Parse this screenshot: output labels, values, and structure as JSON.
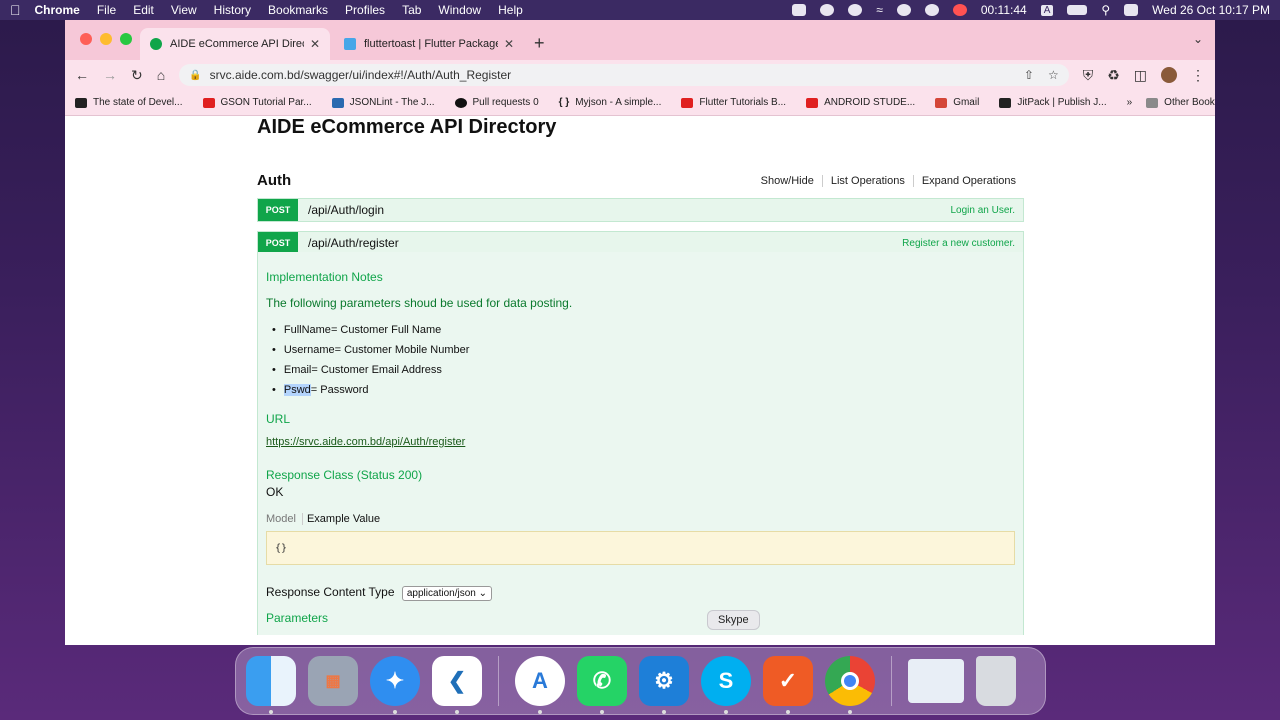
{
  "menubar": {
    "app": "Chrome",
    "items": [
      "File",
      "Edit",
      "View",
      "History",
      "Bookmarks",
      "Profiles",
      "Tab",
      "Window",
      "Help"
    ],
    "timer": "00:11:44",
    "keyboard": "A",
    "datetime": "Wed 26 Oct  10:17 PM"
  },
  "tabs": [
    {
      "title": "AIDE eCommerce API Directory",
      "favicon_color": "#10a54a"
    },
    {
      "title": "fluttertoast | Flutter Package",
      "favicon_color": "#47a6e8"
    }
  ],
  "address": {
    "url": "srvc.aide.com.bd/swagger/ui/index#!/Auth/Auth_Register"
  },
  "bookmarks": [
    {
      "label": "The state of Devel...",
      "icon_color": "#222"
    },
    {
      "label": "GSON Tutorial Par...",
      "icon_color": "#e02020"
    },
    {
      "label": "JSONLint - The J...",
      "icon_color": "#2a6ab0"
    },
    {
      "label": "Pull requests 0",
      "icon_color": "#111"
    },
    {
      "label": "Myjson - A simple...",
      "icon_color": "#444"
    },
    {
      "label": "Flutter Tutorials B...",
      "icon_color": "#e02020"
    },
    {
      "label": "ANDROID STUDE...",
      "icon_color": "#e02020"
    },
    {
      "label": "Gmail",
      "icon_color": "#d44638"
    },
    {
      "label": "JitPack | Publish J...",
      "icon_color": "#222"
    }
  ],
  "bookmarks_more": "»",
  "other_bookmarks": "Other Bookmarks",
  "page": {
    "title": "AIDE eCommerce API Directory",
    "section": "Auth",
    "ops": [
      "Show/Hide",
      "List Operations",
      "Expand Operations"
    ],
    "endpoints": [
      {
        "verb": "POST",
        "path": "/api/Auth/login",
        "summary": "Login an User."
      },
      {
        "verb": "POST",
        "path": "/api/Auth/register",
        "summary": "Register a new customer."
      }
    ],
    "impl_notes_title": "Implementation Notes",
    "impl_notes_text": "The following parameters shoud be used for data posting.",
    "params": [
      {
        "name": "FullName",
        "desc": " = Customer Full Name"
      },
      {
        "name": "Username",
        "desc": " = Customer Mobile Number"
      },
      {
        "name": "Email",
        "desc": " = Customer Email Address"
      },
      {
        "name": "Pswd",
        "desc": " = Password"
      }
    ],
    "url_title": "URL",
    "url_link": "https://srvc.aide.com.bd/api/Auth/register",
    "response_class_title": "Response Class (Status 200)",
    "response_class_value": "OK",
    "model_tab": "Model",
    "example_tab": "Example Value",
    "example_value": "{}",
    "content_type_label": "Response Content Type",
    "content_type_value": "application/json",
    "parameters_title": "Parameters"
  },
  "dock": {
    "tooltip": "Skype",
    "apps": [
      {
        "name": "finder-icon",
        "color": "#3a9ef0"
      },
      {
        "name": "launchpad-icon",
        "color": "#9aa4b4"
      },
      {
        "name": "safari-icon",
        "color": "#2f8ef0"
      },
      {
        "name": "vscode-icon",
        "color": "#1f6fb8"
      },
      {
        "name": "android-studio-icon",
        "color": "#ffffff"
      },
      {
        "name": "whatsapp-icon",
        "color": "#25d366"
      },
      {
        "name": "xcode-icon",
        "color": "#1e7fd8"
      },
      {
        "name": "skype-icon",
        "color": "#00aff0"
      },
      {
        "name": "postman-icon",
        "color": "#ef5b25"
      },
      {
        "name": "chrome-icon",
        "color": "#ffffff"
      },
      {
        "name": "screenshot-preview-icon",
        "color": "#e8eef6"
      },
      {
        "name": "trash-icon",
        "color": "#d8dbe0"
      }
    ]
  }
}
